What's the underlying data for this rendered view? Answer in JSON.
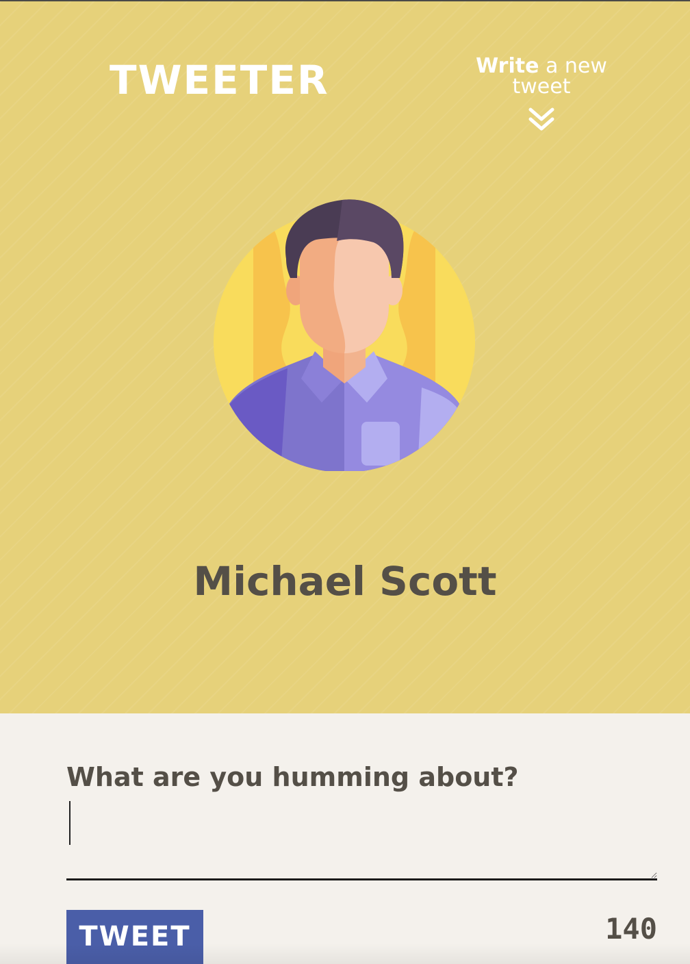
{
  "header": {
    "brand": "TWEETER",
    "write_link": {
      "bold": "Write",
      "rest": " a new tweet",
      "icon": "double-chevron-down-icon"
    }
  },
  "profile": {
    "name": "Michael Scott",
    "avatar_icon": "user-avatar-illustration"
  },
  "composer": {
    "label": "What are you humming about?",
    "value": "",
    "submit_label": "TWEET",
    "char_count": "140"
  },
  "colors": {
    "hero_bg": "#e6d17a",
    "composer_bg": "#f4f1ec",
    "button_bg": "#4a5ea8",
    "text_dark": "#544f47"
  }
}
